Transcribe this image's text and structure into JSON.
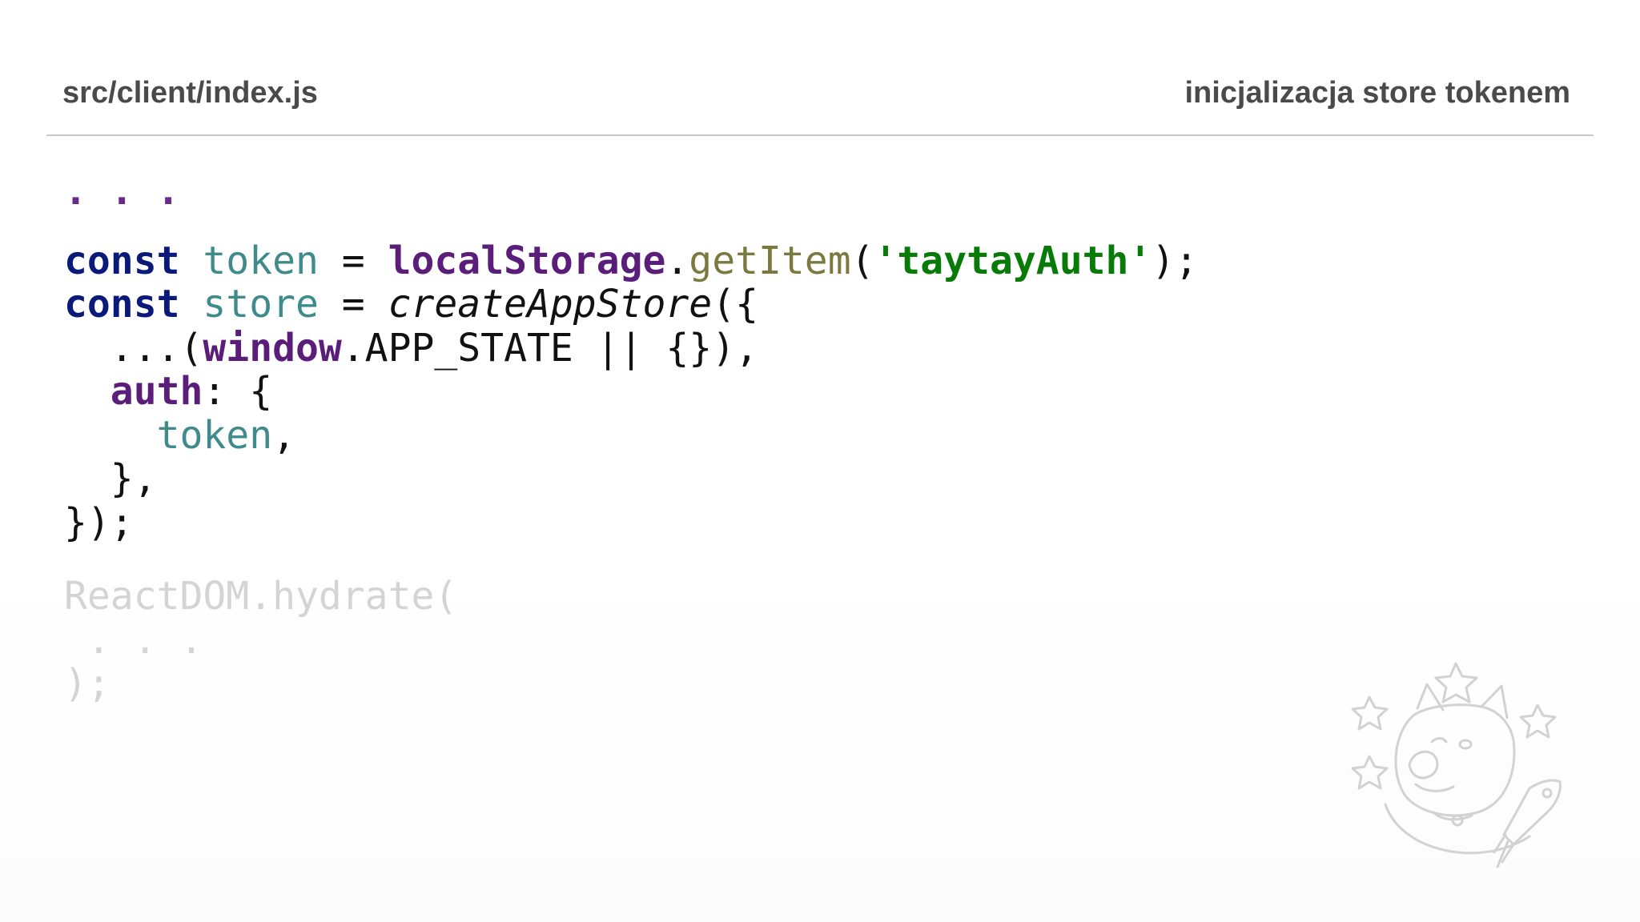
{
  "header": {
    "file_path": "src/client/index.js",
    "slide_title": "inicjalizacja store tokenem"
  },
  "code": {
    "ellipsis_top": ". . .",
    "line1": {
      "kw": "const",
      "var": "token",
      "op": " = ",
      "obj": "localStorage",
      "dot": ".",
      "method": "getItem",
      "open": "(",
      "str": "'taytayAuth'",
      "close": ");"
    },
    "line2": {
      "kw": "const",
      "var": "store",
      "op": " = ",
      "fn": "createAppStore",
      "rest": "({"
    },
    "line3": {
      "indent": "  ",
      "pre": "...(",
      "obj": "window",
      "rest": ".APP_STATE || {}),"
    },
    "line4": {
      "indent": "  ",
      "prop": "auth",
      "rest": ": {"
    },
    "line5": {
      "indent": "    ",
      "var": "token",
      "rest": ","
    },
    "line6": "  },",
    "line7": "});"
  },
  "faded_code": {
    "line1": "ReactDOM.hydrate(",
    "line2": " . . .",
    "line3": ");"
  },
  "decoration": {
    "icon": "doge-astronaut-icon"
  }
}
